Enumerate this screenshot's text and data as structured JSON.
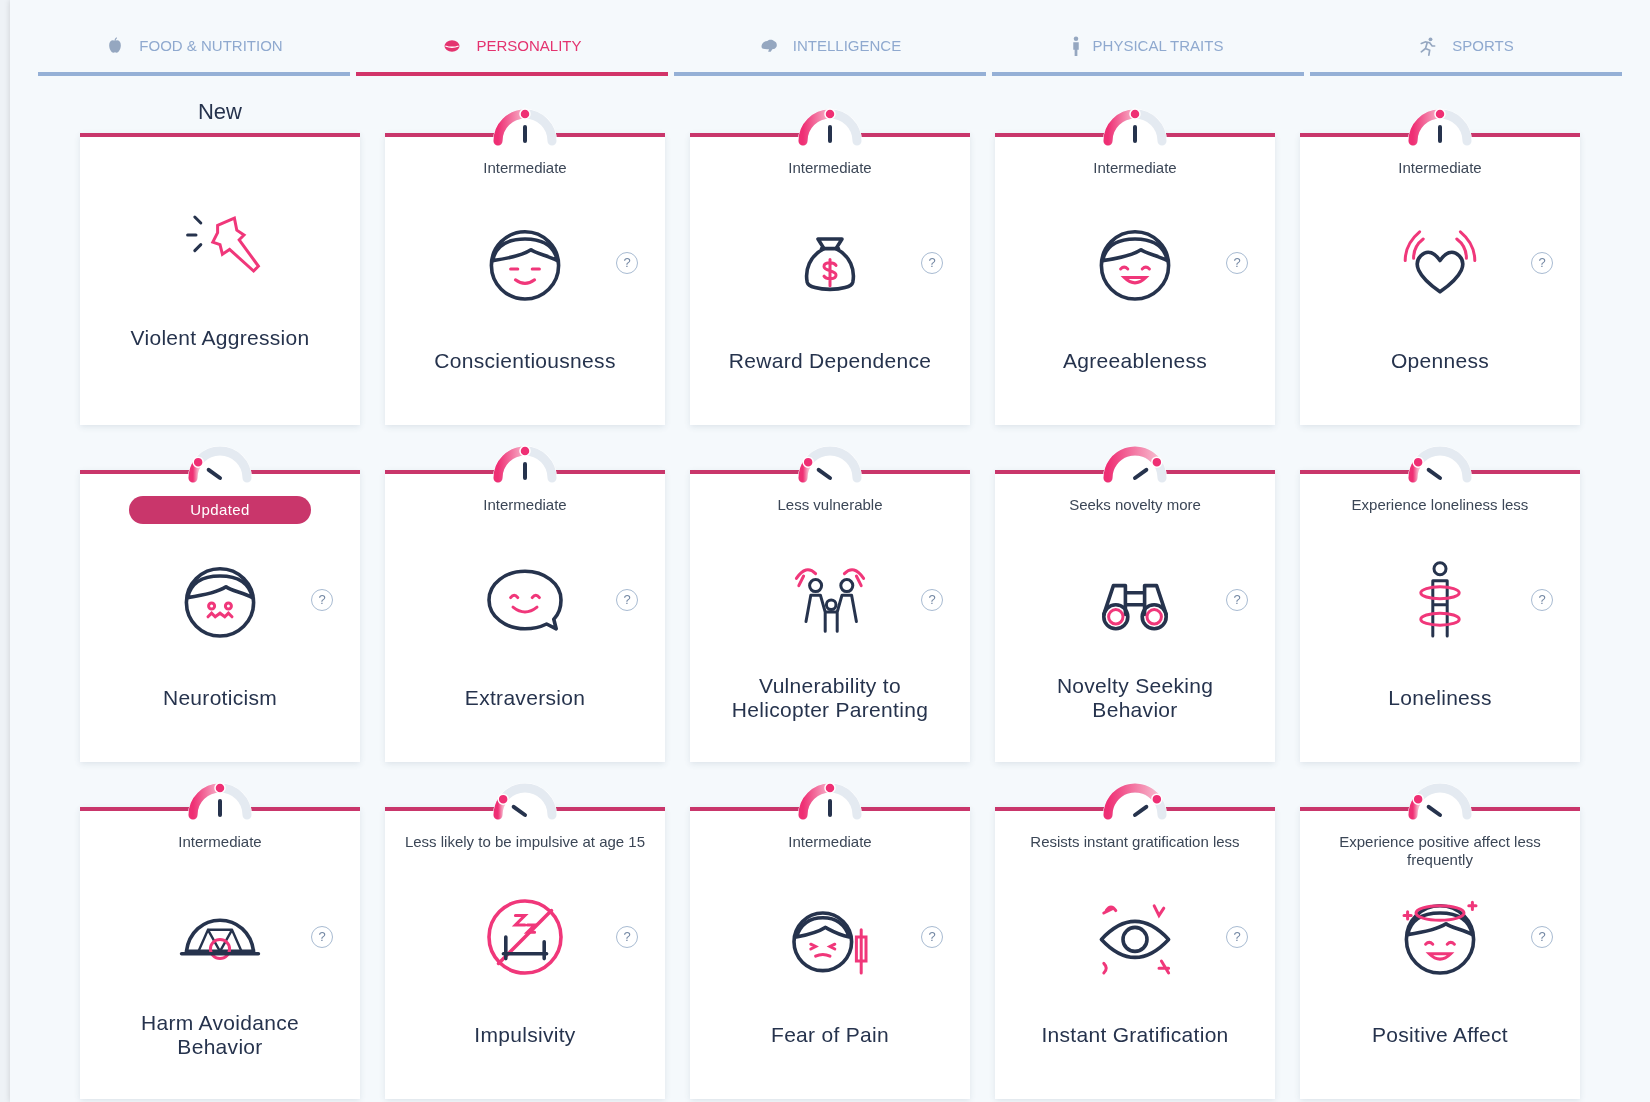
{
  "tabs": [
    {
      "label": "FOOD & NUTRITION",
      "selected": false
    },
    {
      "label": "PERSONALITY",
      "selected": true
    },
    {
      "label": "INTELLIGENCE",
      "selected": false
    },
    {
      "label": "PHYSICAL TRAITS",
      "selected": false
    },
    {
      "label": "SPORTS",
      "selected": false
    }
  ],
  "cards": [
    {
      "kind": "new",
      "title": "Violent Aggression",
      "top_label": "New"
    },
    {
      "kind": "mid",
      "title": "Conscientiousness",
      "reading": "Intermediate",
      "help": "?"
    },
    {
      "kind": "mid",
      "title": "Reward Dependence",
      "reading": "Intermediate",
      "help": "?"
    },
    {
      "kind": "mid",
      "title": "Agreeableness",
      "reading": "Intermediate",
      "help": "?"
    },
    {
      "kind": "mid",
      "title": "Openness",
      "reading": "Intermediate",
      "help": "?"
    },
    {
      "kind": "low",
      "title": "Neuroticism",
      "badge": "Updated",
      "help": "?"
    },
    {
      "kind": "mid",
      "title": "Extraversion",
      "reading": "Intermediate",
      "help": "?"
    },
    {
      "kind": "low",
      "title": "Vulnerability to Helicopter Parenting",
      "reading": "Less vulnerable",
      "help": "?"
    },
    {
      "kind": "high",
      "title": "Novelty Seeking Behavior",
      "reading": "Seeks novelty more",
      "help": "?"
    },
    {
      "kind": "low",
      "title": "Loneliness",
      "reading": "Experience loneliness less",
      "help": "?"
    },
    {
      "kind": "mid",
      "title": "Harm Avoidance Behavior",
      "reading": "Intermediate",
      "help": "?"
    },
    {
      "kind": "low",
      "title": "Impulsivity",
      "reading": "Less likely to be impulsive at age 15",
      "help": "?"
    },
    {
      "kind": "mid",
      "title": "Fear of Pain",
      "reading": "Intermediate",
      "help": "?"
    },
    {
      "kind": "high",
      "title": "Instant Gratification",
      "reading": "Resists instant gratification less",
      "help": "?"
    },
    {
      "kind": "low",
      "title": "Positive Affect",
      "reading": "Experience positive affect less frequently",
      "help": "?"
    }
  ]
}
